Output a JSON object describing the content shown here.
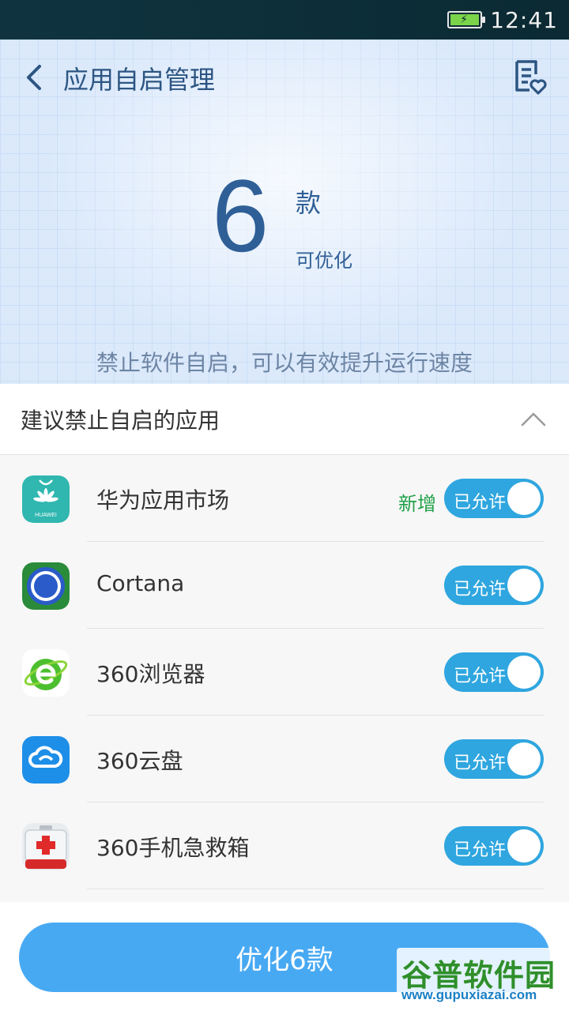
{
  "status_bar": {
    "time": "12:41"
  },
  "header": {
    "title": "应用自启管理"
  },
  "summary": {
    "count": "6",
    "unit": "款",
    "sub_label": "可优化",
    "description": "禁止软件自启，可以有效提升运行速度"
  },
  "section": {
    "title": "建议禁止自启的应用"
  },
  "apps": [
    {
      "name": "华为应用市场",
      "tag": "新增",
      "toggle_label": "已允许",
      "icon": "huawei-appgallery-icon",
      "icon_text": "HUAWEI"
    },
    {
      "name": "Cortana",
      "tag": "",
      "toggle_label": "已允许",
      "icon": "cortana-icon"
    },
    {
      "name": "360浏览器",
      "tag": "",
      "toggle_label": "已允许",
      "icon": "360-browser-icon"
    },
    {
      "name": "360云盘",
      "tag": "",
      "toggle_label": "已允许",
      "icon": "360-cloud-icon"
    },
    {
      "name": "360手机急救箱",
      "tag": "",
      "toggle_label": "已允许",
      "icon": "first-aid-kit-icon"
    }
  ],
  "footer": {
    "optimize_label": "优化6款"
  },
  "watermark": {
    "text": "谷普软件园",
    "url": "www.gupuxiazai.com"
  },
  "colors": {
    "accent": "#48a9f3",
    "toggle_on": "#2fa6df",
    "new_tag": "#22a14a",
    "title": "#2c5582"
  }
}
